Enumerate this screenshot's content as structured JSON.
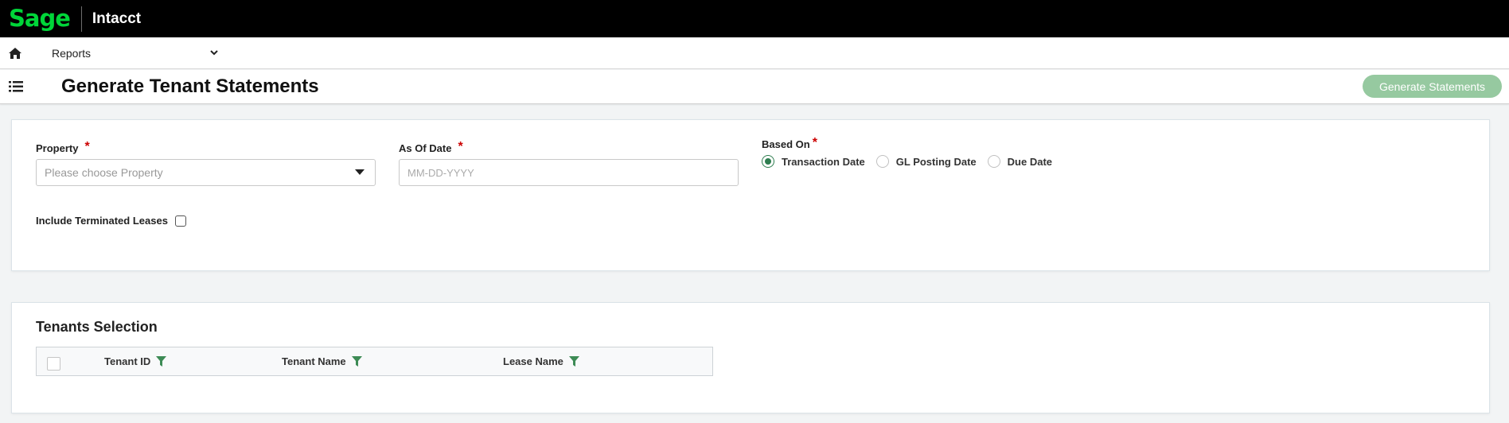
{
  "header": {
    "logo_text": "Sage",
    "product": "Intacct",
    "brand_color": "#00d639"
  },
  "nav": {
    "home_icon": "home-icon",
    "menu_label": "Reports"
  },
  "titlebar": {
    "menu_icon": "list-icon",
    "title": "Generate Tenant Statements",
    "generate_button": "Generate Statements",
    "generate_button_color": "#96c9a0"
  },
  "form": {
    "property": {
      "label": "Property",
      "placeholder": "Please choose Property",
      "required": "*"
    },
    "as_of_date": {
      "label": "As Of Date",
      "placeholder": "MM-DD-YYYY",
      "required": "*"
    },
    "based_on": {
      "label": "Based On",
      "required": "*",
      "options": [
        {
          "label": "Transaction Date",
          "selected": true
        },
        {
          "label": "GL Posting Date",
          "selected": false
        },
        {
          "label": "Due Date",
          "selected": false
        }
      ]
    },
    "include_terminated": {
      "label": "Include Terminated Leases",
      "checked": false
    }
  },
  "tenants": {
    "title": "Tenants Selection",
    "columns": [
      "Tenant ID",
      "Tenant Name",
      "Lease Name"
    ],
    "filter_icon_color": "#3d8b55"
  }
}
